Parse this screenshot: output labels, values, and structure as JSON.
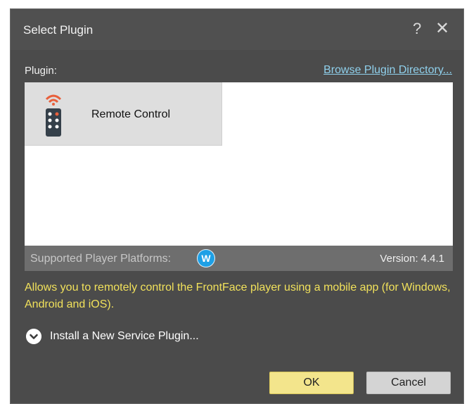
{
  "window": {
    "title": "Select Plugin",
    "help_label": "?",
    "close_label": "✕"
  },
  "plugin_section": {
    "label": "Plugin:",
    "browse_link": "Browse Plugin Directory..."
  },
  "plugins": [
    {
      "name": "Remote Control",
      "icon": "remote-control-icon",
      "selected": true
    }
  ],
  "platforms": {
    "label": "Supported Player Platforms:",
    "badge": "W",
    "badge_color": "#1ea0e6"
  },
  "version": {
    "label": "Version:",
    "value": "4.4.1"
  },
  "description": "Allows you to remotely control the FrontFace player using a mobile app (for Windows, Android and iOS).",
  "install": {
    "label": "Install a New Service Plugin..."
  },
  "buttons": {
    "ok": "OK",
    "cancel": "Cancel"
  },
  "colors": {
    "dialog_bg": "#4b4b4b",
    "description_text": "#f1e15b",
    "link": "#8fd0ec",
    "ok_button": "#f3e58c"
  }
}
